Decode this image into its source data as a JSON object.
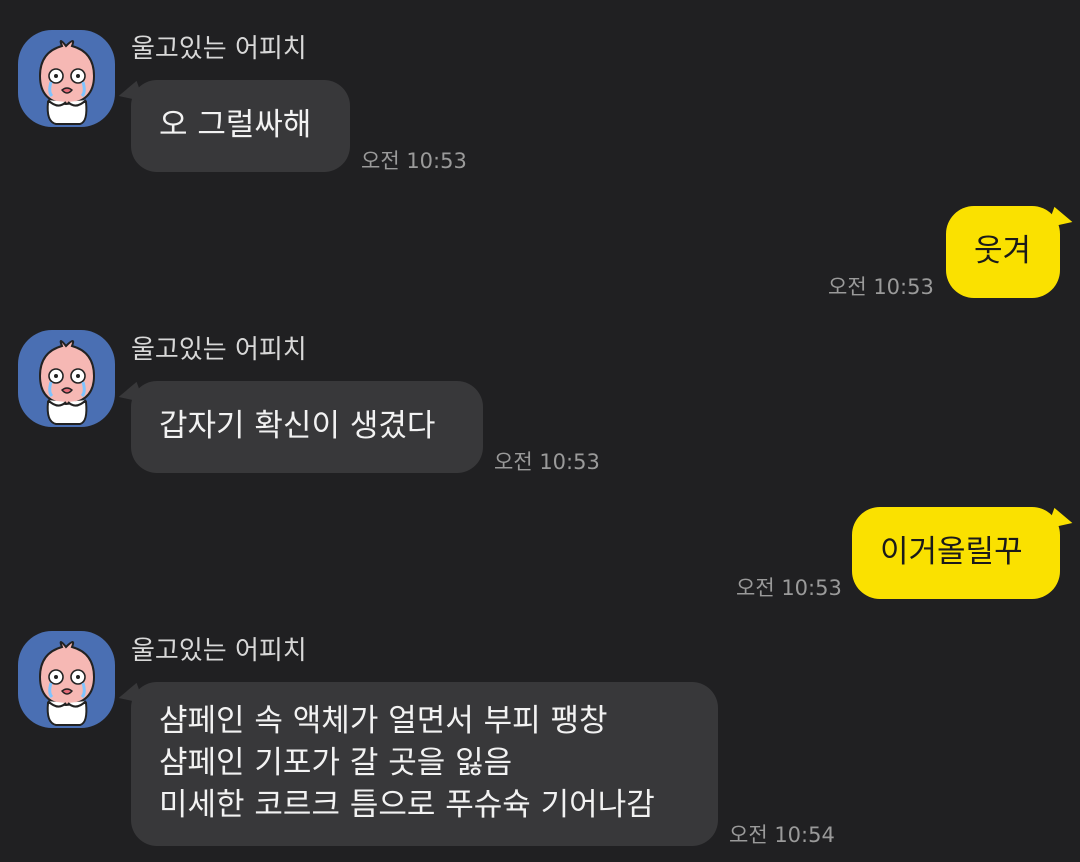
{
  "colors": {
    "background": "#202022",
    "incoming_bubble": "#38383a",
    "outgoing_bubble": "#fae100",
    "avatar_bg": "#4a6fb3",
    "timestamp": "#9a9a9a"
  },
  "messages": [
    {
      "direction": "incoming",
      "sender": "울고있는 어피치",
      "avatar_icon": "apeach-crying-icon",
      "lines": [
        "오 그럴싸해"
      ],
      "time": "오전 10:53"
    },
    {
      "direction": "outgoing",
      "lines": [
        "웃겨"
      ],
      "time": "오전 10:53"
    },
    {
      "direction": "incoming",
      "sender": "울고있는 어피치",
      "avatar_icon": "apeach-crying-icon",
      "lines": [
        "갑자기 확신이 생겼다"
      ],
      "time": "오전 10:53"
    },
    {
      "direction": "outgoing",
      "lines": [
        "이거올릴꾸"
      ],
      "time": "오전 10:53"
    },
    {
      "direction": "incoming",
      "sender": "울고있는 어피치",
      "avatar_icon": "apeach-crying-icon",
      "lines": [
        "샴페인 속 액체가 얼면서 부피 팽창",
        "샴페인 기포가 갈 곳을 잃음",
        "미세한 코르크 틈으로 푸슈슉 기어나감"
      ],
      "time": "오전 10:54"
    }
  ]
}
